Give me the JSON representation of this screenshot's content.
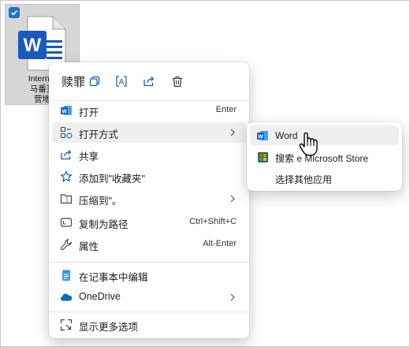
{
  "file": {
    "name_line1": "Internet",
    "name_line2": "马番克",
    "name_line3": "营地"
  },
  "context_menu": {
    "top_actions": [
      {
        "label": "赎罪",
        "icon": "copy-icon"
      },
      {
        "label": "",
        "icon": "rename-icon"
      },
      {
        "label": "",
        "icon": "share-icon"
      },
      {
        "label": "",
        "icon": "delete-icon"
      }
    ],
    "items": [
      {
        "label": "打开",
        "shortcut": "Enter",
        "icon": "word-app-icon"
      },
      {
        "label": "打开方式",
        "shortcut": "",
        "icon": "open-with-icon",
        "has_submenu": true
      },
      {
        "label": "共享",
        "shortcut": "",
        "icon": "share-icon"
      },
      {
        "label": "添加到\"收藏夹\"",
        "shortcut": "",
        "icon": "star-icon"
      },
      {
        "label": "压缩到\"。",
        "shortcut": "",
        "icon": "zip-icon",
        "has_submenu": true
      },
      {
        "label": "复制为路径",
        "shortcut": "Ctrl+Shift+C",
        "icon": "copy-path-icon"
      },
      {
        "label": "属性",
        "shortcut": "Alt-Enter",
        "icon": "wrench-icon"
      },
      {
        "label": "在记事本中编辑",
        "shortcut": "",
        "icon": "notepad-icon"
      },
      {
        "label": "OneDrive",
        "shortcut": "",
        "icon": "onedrive-icon",
        "has_submenu": true
      },
      {
        "label": "显示更多选项",
        "shortcut": "",
        "icon": "more-options-icon"
      }
    ]
  },
  "submenu": {
    "items": [
      {
        "label": "Word",
        "icon": "word-app-icon"
      },
      {
        "label": "搜索 e Microsoft Store",
        "icon": "store-icon"
      },
      {
        "label": "选择其他应用",
        "icon": ""
      }
    ]
  },
  "colors": {
    "word_blue": "#185abd",
    "accent_blue": "#1f6fd1",
    "onedrive_blue": "#0f6cbd",
    "highlight": "#efefef"
  }
}
